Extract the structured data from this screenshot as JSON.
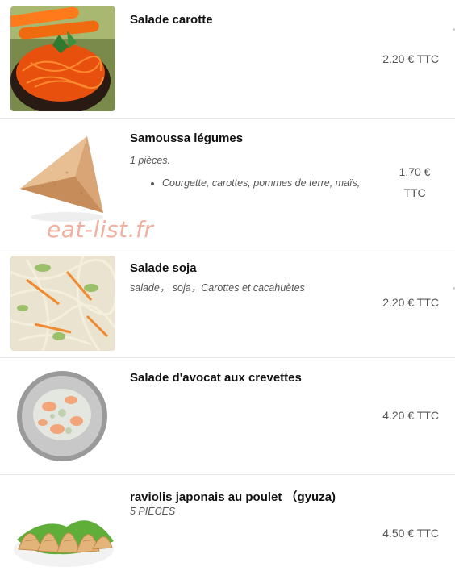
{
  "menu": {
    "items": [
      {
        "name": "Salade carotte",
        "description": "",
        "price": "2.20 € TTC",
        "image": "carrot-salad-photo"
      },
      {
        "name": "Samoussa légumes",
        "description": "1 pièces.",
        "bullets": [
          "Courgette, carottes, pommes de terre, maïs,"
        ],
        "price": "1.70 € TTC",
        "image": "samosa-photo"
      },
      {
        "name": "Salade soja",
        "description": "salade， soja，Carottes et cacahuètes",
        "price": "2.20 € TTC",
        "image": "soy-salad-photo"
      },
      {
        "name": "Salade d'avocat aux crevettes",
        "description": "",
        "price": "4.20 € TTC",
        "image": "avocado-shrimp-salad-photo"
      },
      {
        "name": "raviolis japonais au poulet （gyuza)",
        "description": "5 PIÈCES",
        "price": "4.50 € TTC",
        "image": "gyoza-photo"
      }
    ]
  },
  "watermark": "eat-list.fr"
}
